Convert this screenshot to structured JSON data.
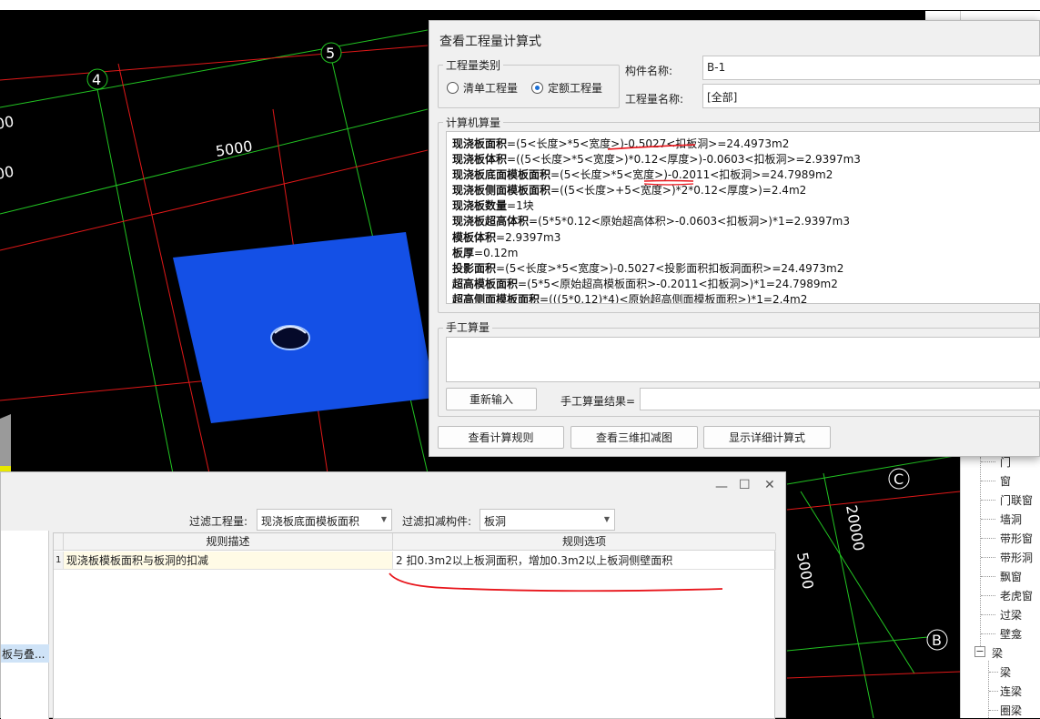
{
  "viewport": {
    "grid_labels": [
      "4",
      "5",
      "C",
      "B"
    ],
    "dimensions": [
      "5000",
      "00",
      "00",
      "20000",
      "5000"
    ]
  },
  "calc_dialog": {
    "title": "查看工程量计算式",
    "quantity_category": {
      "legend": "工程量类别",
      "options": [
        {
          "label": "清单工程量",
          "selected": false
        },
        {
          "label": "定额工程量",
          "selected": true
        }
      ]
    },
    "component_name_label": "构件名称:",
    "component_name_value": "B-1",
    "quantity_name_label": "工程量名称:",
    "quantity_name_value": "[全部]",
    "computer_calc_legend": "计算机算量",
    "formulas": [
      {
        "name": "现浇板面积",
        "expr": "=(5<长度>*5<宽度>)-0.5027<扣板洞>=24.4973m2"
      },
      {
        "name": "现浇板体积",
        "expr": "=((5<长度>*5<宽度>)*0.12<厚度>)-0.0603<扣板洞>=2.9397m3"
      },
      {
        "name": "现浇板底面模板面积",
        "expr": "=(5<长度>*5<宽度>)-0.2011<扣板洞>=24.7989m2"
      },
      {
        "name": "现浇板侧面模板面积",
        "expr": "=((5<长度>+5<宽度>)*2*0.12<厚度>)=2.4m2"
      },
      {
        "name": "现浇板数量",
        "expr": "=1块"
      },
      {
        "name": "现浇板超高体积",
        "expr": "=(5*5*0.12<原始超高体积>-0.0603<扣板洞>)*1=2.9397m3"
      },
      {
        "name": "模板体积",
        "expr": "=2.9397m3"
      },
      {
        "name": "板厚",
        "expr": "=0.12m"
      },
      {
        "name": "投影面积",
        "expr": "=(5<长度>*5<宽度>)-0.5027<投影面积扣板洞面积>=24.4973m2"
      },
      {
        "name": "超高模板面积",
        "expr": "=(5*5<原始超高模板面积>-0.2011<扣板洞>)*1=24.7989m2"
      },
      {
        "name": "超高侧面模板面积",
        "expr": "=(((5*0.12)*4)<原始超高侧面模板面积>)*1=2.4m2"
      }
    ],
    "manual_calc_legend": "手工算量",
    "reenter_button": "重新输入",
    "manual_result_label": "手工算量结果=",
    "manual_result_value": "",
    "buttons": [
      "查看计算规则",
      "查看三维扣减图",
      "显示详细计算式"
    ]
  },
  "rule_window": {
    "left_item": "板与叠...",
    "filter_qty_label": "过滤工程量:",
    "filter_qty_value": "现浇板底面模板面积",
    "filter_comp_label": "过滤扣减构件:",
    "filter_comp_value": "板洞",
    "columns": [
      "规则描述",
      "规则选项"
    ],
    "rows": [
      {
        "index": "1",
        "description": "现浇板模板面积与板洞的扣减",
        "option": "2  扣0.3m2以上板洞面积，增加0.3m2以上板洞侧壁面积"
      }
    ]
  },
  "tree": {
    "items": [
      {
        "label": "门",
        "group": false
      },
      {
        "label": "窗",
        "group": false
      },
      {
        "label": "门联窗",
        "group": false
      },
      {
        "label": "墙洞",
        "group": false
      },
      {
        "label": "带形窗",
        "group": false
      },
      {
        "label": "带形洞",
        "group": false
      },
      {
        "label": "飘窗",
        "group": false
      },
      {
        "label": "老虎窗",
        "group": false
      },
      {
        "label": "过梁",
        "group": false
      },
      {
        "label": "壁龛",
        "group": false
      },
      {
        "label": "梁",
        "group": true
      },
      {
        "label": "梁",
        "group": false
      },
      {
        "label": "连梁",
        "group": false
      },
      {
        "label": "圈梁",
        "group": false
      }
    ]
  },
  "colors": {
    "slab": "#1450e6",
    "grid_green": "#22c422",
    "grid_red": "#e01818",
    "annotation_red": "#e8151b",
    "radio_selected": "#1a6fd6"
  }
}
